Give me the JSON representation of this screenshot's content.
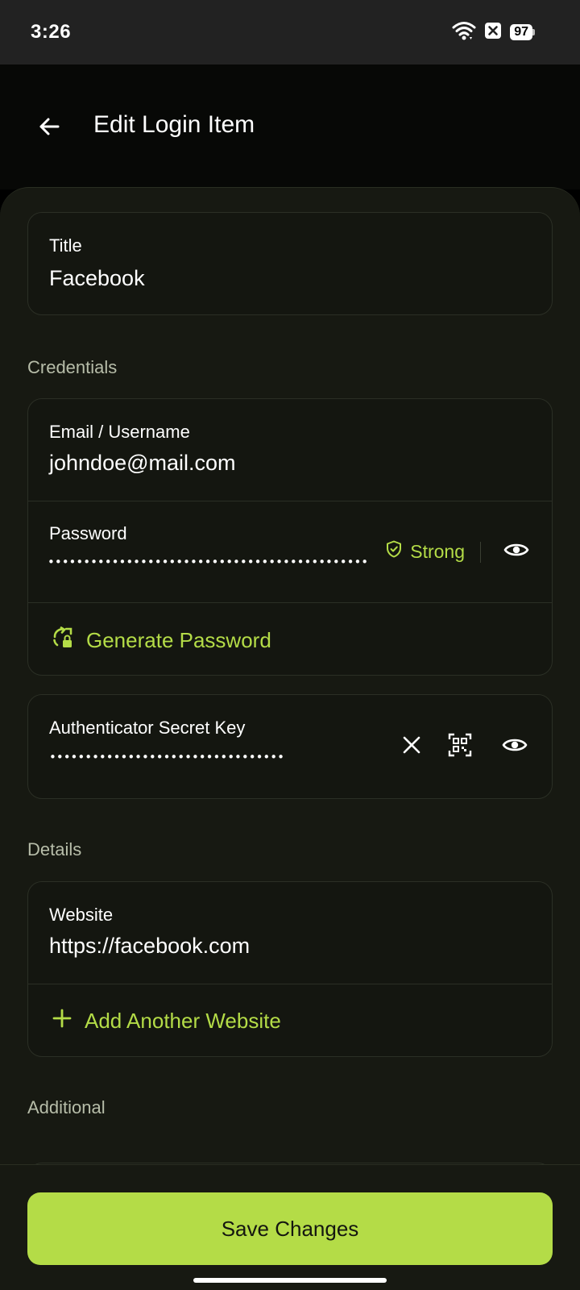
{
  "status_bar": {
    "time": "3:26",
    "battery": "97",
    "icons": [
      "wifi-icon",
      "close-box-icon",
      "battery-icon"
    ]
  },
  "app_bar": {
    "title": "Edit Login Item",
    "back_icon": "arrow-left-icon"
  },
  "title_field": {
    "label": "Title",
    "value": "Facebook"
  },
  "credentials": {
    "section_label": "Credentials",
    "username_label": "Email / Username",
    "username_value": "johndoe@mail.com",
    "password_label": "Password",
    "password_masked": "••••••••••••••••••••••••••••••••••••••••••••••",
    "strength_label": "Strong",
    "generate_label": "Generate Password"
  },
  "authenticator": {
    "label": "Authenticator Secret Key",
    "masked": "••••••••••••••••••••••••••••••••••"
  },
  "details": {
    "section_label": "Details",
    "website_label": "Website",
    "website_value": "https://facebook.com",
    "add_website_label": "Add Another Website"
  },
  "additional": {
    "section_label": "Additional"
  },
  "save_button": {
    "label": "Save Changes"
  },
  "colors": {
    "accent": "#b4dc47",
    "background": "#171912",
    "card": "#141610",
    "border": "#2b2f25"
  }
}
